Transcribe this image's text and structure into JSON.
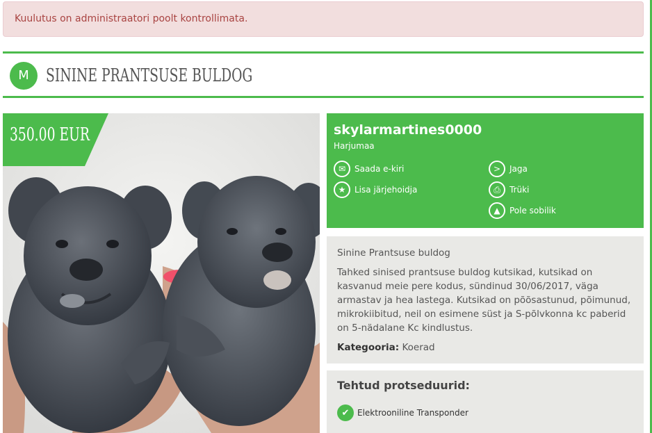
{
  "alert": {
    "text": "Kuulutus on administraatori poolt kontrollimata."
  },
  "listing": {
    "badge_letter": "M",
    "title": "SININE PRANTSUSE BULDOG",
    "price": "350.00 EUR"
  },
  "seller": {
    "name": "skylarmartines0000",
    "location": "Harjumaa",
    "actions": {
      "email": "Saada e-kiri",
      "bookmark": "Lisa järjehoidja",
      "share": "Jaga",
      "print": "Trüki",
      "report": "Pole sobilik"
    }
  },
  "description": {
    "title": "Sinine Prantsuse buldog",
    "body": "Tahked sinised prantsuse buldog kutsikad, kutsikad on kasvanud meie pere kodus, sündinud 30/06/2017, väga armastav ja hea lastega. Kutsikad on põõsastunud, põimunud, mikrokiibitud, neil on esimene süst ja S-põlvkonna kc paberid on 5-nädalane Kc kindlustus.",
    "category_label": "Kategooria:",
    "category_value": "Koerad"
  },
  "procedures": {
    "title": "Tehtud protseduurid:",
    "items": [
      "Elektrooniline Transponder"
    ]
  },
  "colors": {
    "accent": "#4cbb4c",
    "alert_bg": "#f2dede",
    "alert_text": "#a94442",
    "panel_bg": "#e9e9e6"
  }
}
